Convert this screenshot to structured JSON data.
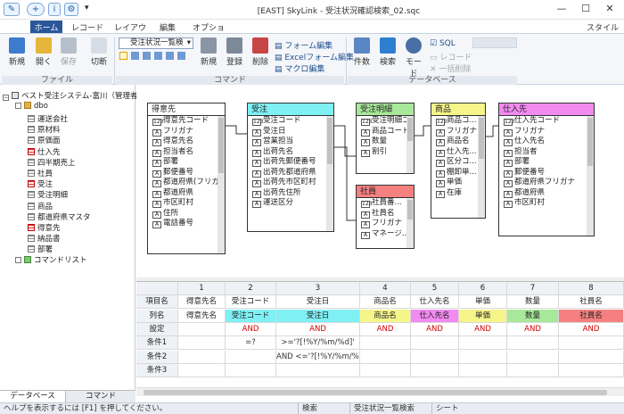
{
  "window": {
    "title": "[EAST] SkyLink - 受注状況確認検索_02.sqc",
    "style_label": "スタイル"
  },
  "ribbon": {
    "tabs": [
      "ホーム",
      "レコード",
      "レイアウト",
      "編集",
      "オプション"
    ],
    "file": {
      "label": "ファイル",
      "new": "新規",
      "open": "開く",
      "save": "保存",
      "cut": "切断"
    },
    "command": {
      "label": "コマンド",
      "dropdown": "受注状況一覧検",
      "new": "新規",
      "register": "登録",
      "delete": "削除",
      "form_edit": "フォーム編集",
      "excel_edit": "Excelフォーム編集",
      "macro_edit": "マクロ編集"
    },
    "database": {
      "label": "データベース",
      "count": "件数",
      "search": "検索",
      "mode": "モード",
      "sql": "SQL",
      "record": "レコード",
      "batch_delete": "一括削除"
    }
  },
  "tree": {
    "root": "ベスト受注システム-富川（管理者）",
    "schema": "dbo",
    "items": [
      "運送会社",
      "原材料",
      "原価面",
      "仕入先",
      "四半期売上",
      "社員",
      "受注",
      "受注明細",
      "商品",
      "都道府県マスタ",
      "得意先",
      "納品書",
      "部署"
    ],
    "command_list": "コマンドリスト",
    "tabs": [
      "データベース",
      "コマンド"
    ]
  },
  "tables": [
    {
      "name": "得意先",
      "color": "#ffffff",
      "fields": [
        "得意先コード",
        "フリガナ",
        "得意先名",
        "担当者名",
        "部署",
        "郵便番号",
        "都道府県(フリガ...",
        "都道府県",
        "市区町村",
        "住所",
        "電話番号"
      ]
    },
    {
      "name": "受注",
      "color": "#7ff0f4",
      "fields": [
        "受注コード",
        "受注日",
        "営業担当",
        "出荷先名",
        "出荷先郵便番号",
        "出荷先都道府県",
        "出荷先市区町村",
        "出荷先住所",
        "運送区分"
      ]
    },
    {
      "name": "受注明細",
      "color": "#a8e89a",
      "fields": [
        "受注明細コ...",
        "商品コード",
        "数量",
        "割引"
      ]
    },
    {
      "name": "商品",
      "color": "#f5f58a",
      "fields": [
        "商品コ...",
        "フリガナ",
        "商品名",
        "仕入先...",
        "区分コ...",
        "棚卸単...",
        "単価",
        "在庫"
      ]
    },
    {
      "name": "仕入先",
      "color": "#f28bf0",
      "fields": [
        "仕入先コード",
        "フリガナ",
        "仕入先名",
        "担当者",
        "部署",
        "郵便番号",
        "都道府県フリガナ",
        "都道府県",
        "市区町村"
      ]
    },
    {
      "name": "社員",
      "color": "#f48080",
      "fields": [
        "社員番...",
        "社員名",
        "フリガナ",
        "マネージ..."
      ]
    }
  ],
  "grid": {
    "col_numbers": [
      "1",
      "2",
      "3",
      "4",
      "5",
      "6",
      "7",
      "8"
    ],
    "row_headers": [
      "項目名",
      "列名",
      "設定",
      "条件1",
      "条件2",
      "条件3"
    ],
    "item_names": [
      "得意先名",
      "受注コード",
      "受注日",
      "商品名",
      "仕入先名",
      "単価",
      "数量",
      "社員名"
    ],
    "column_names": [
      "得意先名",
      "受注コード",
      "受注日",
      "商品名",
      "仕入先名",
      "単価",
      "数量",
      "社員名"
    ],
    "column_colors": [
      "#ffffff",
      "#7ff0f4",
      "#7ff0f4",
      "#f5f58a",
      "#f28bf0",
      "#f5f58a",
      "#a8e89a",
      "#f48080"
    ],
    "settings": [
      "",
      "AND",
      "AND",
      "AND",
      "AND",
      "AND",
      "AND",
      "AND"
    ],
    "cond1": [
      "",
      "=?",
      ">='?[!%Y/%m/%d]'",
      "",
      "",
      "",
      "",
      ""
    ],
    "cond2": [
      "",
      "",
      "AND <='?[!%Y/%m/%d]'",
      "",
      "",
      "",
      "",
      ""
    ],
    "cond3": [
      "",
      "",
      "",
      "",
      "",
      "",
      "",
      ""
    ]
  },
  "status": {
    "help": "ヘルプを表示するには [F1] を押してください。",
    "s1": "検索",
    "s2": "受注状況一覧検索",
    "s3": "シート"
  }
}
